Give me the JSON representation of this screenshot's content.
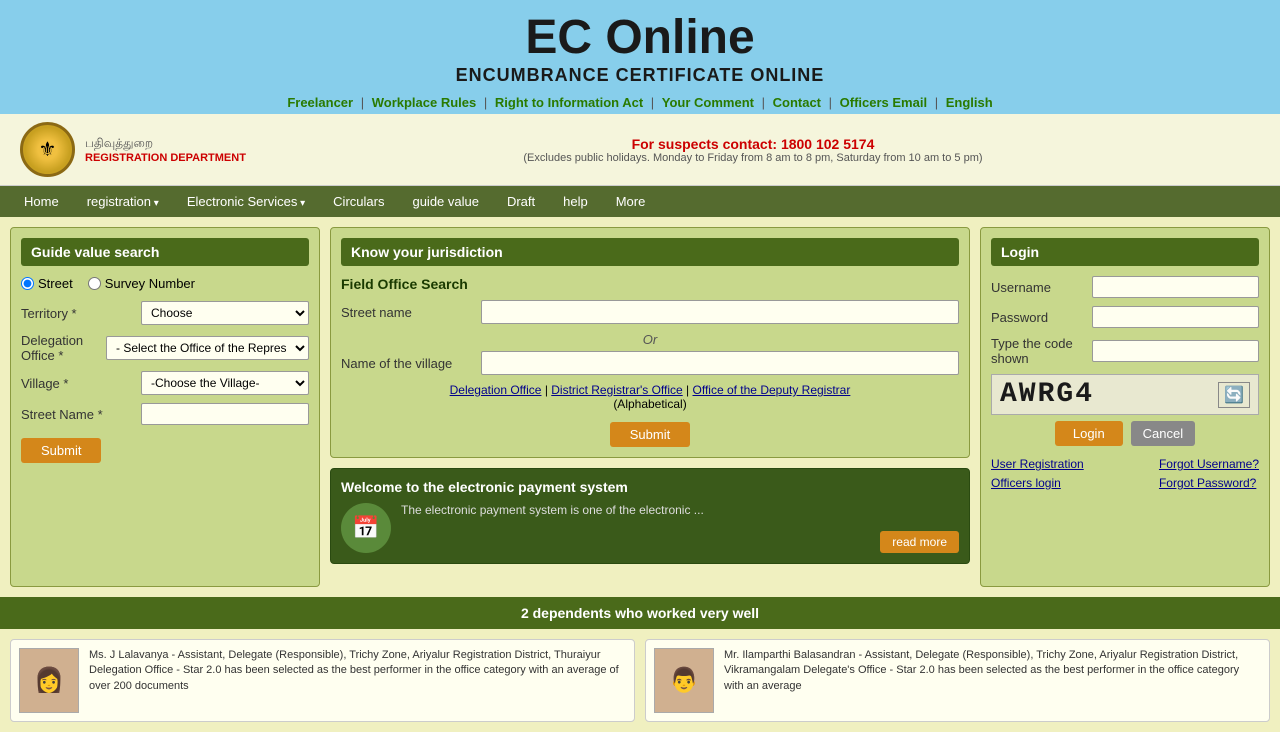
{
  "header": {
    "title": "EC Online",
    "subtitle": "ENCUMBRANCE CERTIFICATE ONLINE",
    "nav": {
      "links": [
        {
          "label": "Freelancer",
          "id": "freelancer"
        },
        {
          "label": "Workplace Rules",
          "id": "workplace-rules"
        },
        {
          "label": "Right to Information Act",
          "id": "rti"
        },
        {
          "label": "Your Comment",
          "id": "your-comment"
        },
        {
          "label": "Contact",
          "id": "contact"
        },
        {
          "label": "Officers Email",
          "id": "officers-email"
        },
        {
          "label": "English",
          "id": "english"
        }
      ]
    }
  },
  "info_bar": {
    "dept_name_ta": "பதிவுத்துறை",
    "dept_name_en": "REGISTRATION DEPARTMENT",
    "hotline_label": "For suspects contact:",
    "hotline_number": "1800 102 5174",
    "hours": "(Excludes public holidays. Monday to Friday from 8 am to 8 pm, Saturday from 10 am to 5 pm)"
  },
  "main_nav": {
    "items": [
      {
        "label": "Home",
        "id": "home"
      },
      {
        "label": "registration",
        "id": "registration",
        "dropdown": true
      },
      {
        "label": "Electronic Services",
        "id": "electronic-services",
        "dropdown": true
      },
      {
        "label": "Circulars",
        "id": "circulars"
      },
      {
        "label": "guide value",
        "id": "guide-value"
      },
      {
        "label": "Draft",
        "id": "draft"
      },
      {
        "label": "help",
        "id": "help"
      },
      {
        "label": "More",
        "id": "more"
      }
    ]
  },
  "guide_value_search": {
    "title": "Guide value search",
    "radio_street": "Street",
    "radio_survey": "Survey Number",
    "territory_label": "Territory *",
    "territory_placeholder": "Choose",
    "delegation_label": "Delegation Office *",
    "delegation_placeholder": "- Select the Office of the Repres",
    "village_label": "Village *",
    "village_placeholder": "-Choose the Village-",
    "street_label": "Street Name *",
    "submit_label": "Submit"
  },
  "jurisdiction": {
    "title": "Know your jurisdiction",
    "field_search_label": "Field Office Search",
    "street_name_label": "Street name",
    "or_text": "Or",
    "village_name_label": "Name of the village",
    "link1": "Delegation Office",
    "link2": "District Registrar's Office",
    "link3": "Office of the Deputy Registrar",
    "alphabetical": "(Alphabetical)",
    "submit_label": "Submit"
  },
  "payment": {
    "title": "Welcome to the electronic payment system",
    "description": "The electronic payment system is one of the electronic ...",
    "read_more_label": "read more"
  },
  "login": {
    "title": "Login",
    "username_label": "Username",
    "password_label": "Password",
    "code_label": "Type the code shown",
    "captcha_text": "AWRG4",
    "login_btn": "Login",
    "cancel_btn": "Cancel",
    "user_registration": "User Registration",
    "forgot_username": "Forgot Username?",
    "forgot_password": "Forgot Password?",
    "officers_login": "Officers login"
  },
  "bottom_bar": {
    "text": "2 dependents who worked very well"
  },
  "performers": [
    {
      "name": "Ms. J Lalavanya",
      "description": "Ms. J Lalavanya - Assistant, Delegate (Responsible), Trichy Zone, Ariyalur Registration District, Thuraiyur Delegation Office - Star 2.0 has been selected as the best performer in the office category with an average of over 200 documents"
    },
    {
      "name": "Mr. Ilamparthi Balasandran",
      "description": "Mr. Ilamparthi Balasandran - Assistant, Delegate (Responsible), Trichy Zone, Ariyalur Registration District, Vikramangalam Delegate's Office - Star 2.0 has been selected as the best performer in the office category with an average"
    }
  ]
}
